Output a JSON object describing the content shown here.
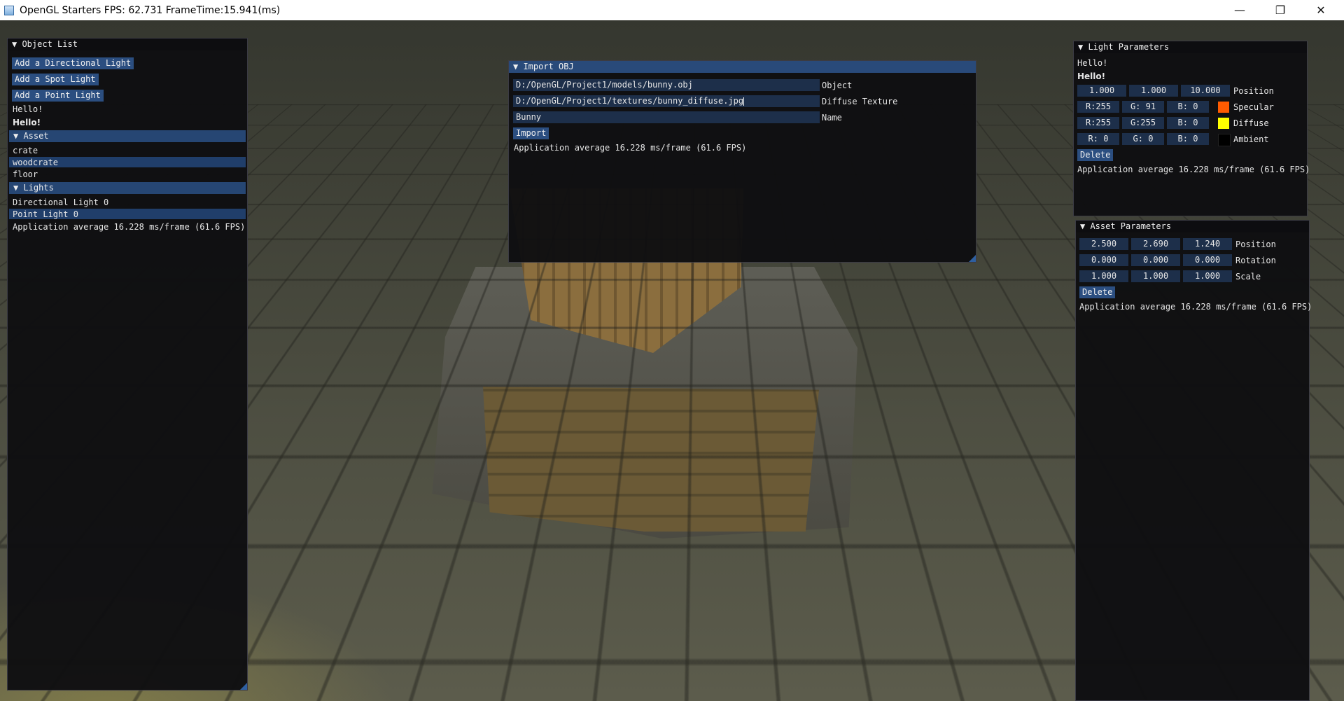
{
  "window": {
    "title": "OpenGL Starters FPS: 62.731 FrameTime:15.941(ms)",
    "minimize_glyph": "—",
    "restore_glyph": "❐",
    "close_glyph": "✕"
  },
  "object_list": {
    "title": "▼ Object List",
    "buttons": [
      "Add a Directional Light",
      "Add a Spot Light",
      "Add a Point Light"
    ],
    "hello_plain": "Hello!",
    "hello_bold": "Hello!",
    "asset_header": "▼ Asset",
    "assets": [
      "crate",
      "woodcrate",
      "floor"
    ],
    "lights_header": "▼ Lights",
    "lights": [
      "Directional Light 0",
      "Point Light 0"
    ],
    "stats": "Application average 16.228 ms/frame (61.6 FPS)"
  },
  "import_obj": {
    "title": "▼ Import OBJ",
    "object_path": "D:/OpenGL/Project1/models/bunny.obj",
    "object_label": "Object",
    "texture_path": "D:/OpenGL/Project1/textures/bunny_diffuse.jpg",
    "texture_label": "Diffuse Texture",
    "name_value": "Bunny",
    "name_label": "Name",
    "import_button": "Import",
    "stats": "Application average 16.228 ms/frame (61.6 FPS)"
  },
  "light_parameters": {
    "title": "▼ Light Parameters",
    "hello_plain": "Hello!",
    "hello_bold": "Hello!",
    "position": [
      "1.000",
      "1.000",
      "10.000"
    ],
    "position_label": "Position",
    "specular": [
      "R:255",
      "G: 91",
      "B:  0"
    ],
    "specular_label": "Specular",
    "specular_color": "#ff5b00",
    "diffuse": [
      "R:255",
      "G:255",
      "B:  0"
    ],
    "diffuse_label": "Diffuse",
    "diffuse_color": "#ffff00",
    "ambient": [
      "R:  0",
      "G:  0",
      "B:  0"
    ],
    "ambient_label": "Ambient",
    "ambient_color": "#000000",
    "delete_button": "Delete",
    "stats": "Application average 16.228 ms/frame (61.6 FPS)"
  },
  "asset_parameters": {
    "title": "▼ Asset Parameters",
    "position": [
      "2.500",
      "2.690",
      "1.240"
    ],
    "position_label": "Position",
    "rotation": [
      "0.000",
      "0.000",
      "0.000"
    ],
    "rotation_label": "Rotation",
    "scale": [
      "1.000",
      "1.000",
      "1.000"
    ],
    "scale_label": "Scale",
    "delete_button": "Delete",
    "stats": "Application average 16.228 ms/frame (61.6 FPS)"
  },
  "theme": {
    "button_color": "#2b4e80",
    "field_color": "#1d2f4a",
    "panel_bg": "#0f0f11"
  }
}
